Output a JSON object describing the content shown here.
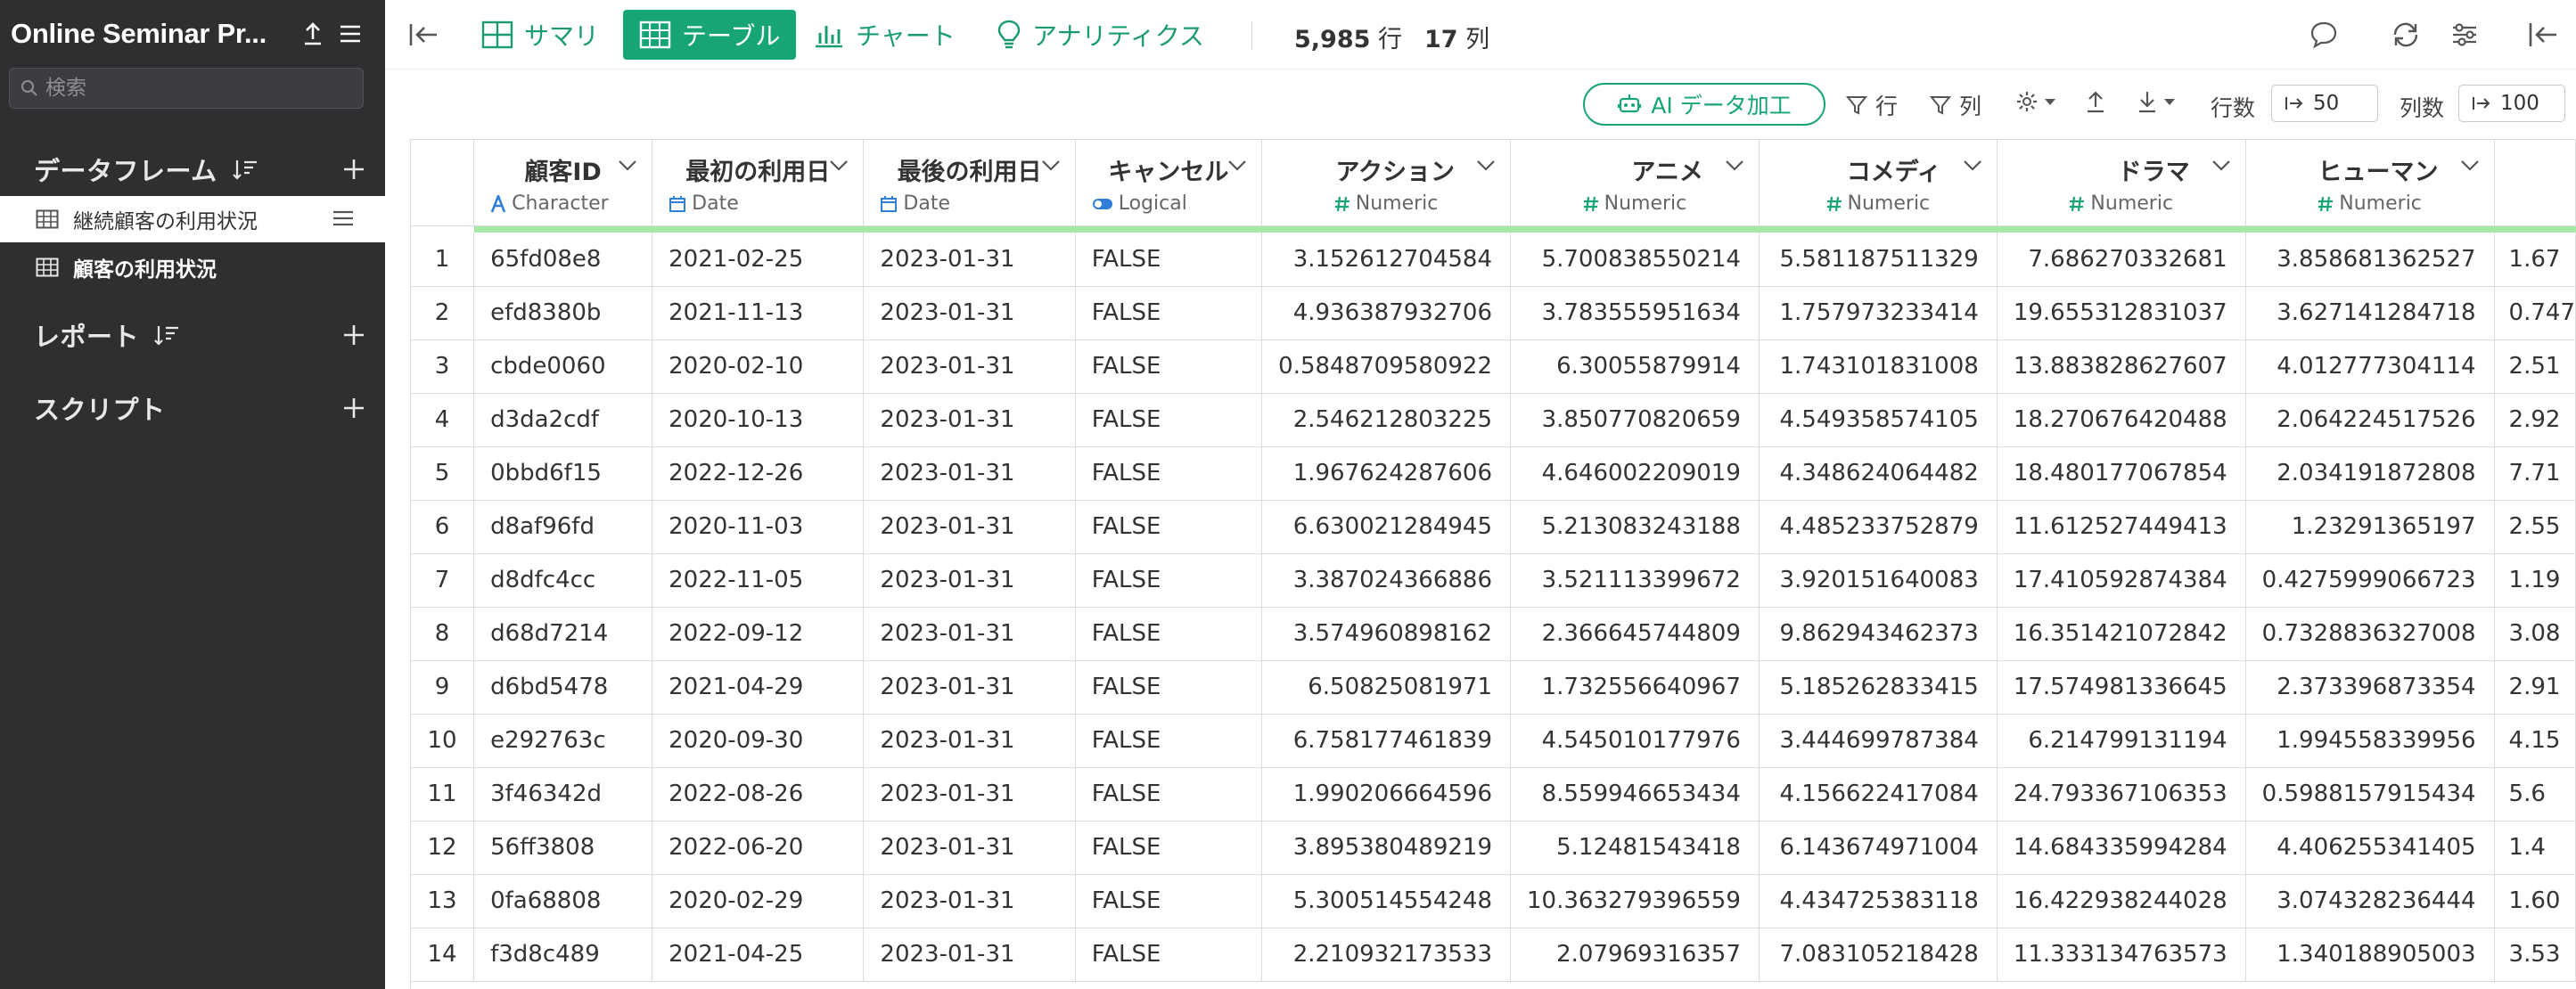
{
  "sidebar": {
    "project_title": "Online Seminar Pr...",
    "search_placeholder": "検索",
    "sections": {
      "dataframes": "データフレーム",
      "reports": "レポート",
      "scripts": "スクリプト"
    },
    "dataframes": [
      {
        "label": "継続顧客の利用状況"
      },
      {
        "label": "顧客の利用状況"
      }
    ]
  },
  "toolbar": {
    "summary": "サマリ",
    "table": "テーブル",
    "chart": "チャート",
    "analytics": "アナリティクス",
    "row_count": "5,985",
    "row_unit": "行",
    "col_count": "17",
    "col_unit": "列"
  },
  "subbar": {
    "ai_label": "AI データ加工",
    "row_filter": "行",
    "col_filter": "列",
    "rows_label": "行数",
    "rows_value": "50",
    "cols_label": "列数",
    "cols_value": "100"
  },
  "table": {
    "columns": [
      {
        "name": "顧客ID",
        "type": "Character"
      },
      {
        "name": "最初の利用日",
        "type": "Date"
      },
      {
        "name": "最後の利用日",
        "type": "Date"
      },
      {
        "name": "キャンセル",
        "type": "Logical"
      },
      {
        "name": "アクション",
        "type": "Numeric"
      },
      {
        "name": "アニメ",
        "type": "Numeric"
      },
      {
        "name": "コメディ",
        "type": "Numeric"
      },
      {
        "name": "ドラマ",
        "type": "Numeric"
      },
      {
        "name": "ヒューマン",
        "type": "Numeric"
      }
    ],
    "rows": [
      [
        "1",
        "65fd08e8",
        "2021-02-25",
        "2023-01-31",
        "FALSE",
        "3.152612704584",
        "5.700838550214",
        "5.581187511329",
        "7.686270332681",
        "3.858681362527",
        "1.67"
      ],
      [
        "2",
        "efd8380b",
        "2021-11-13",
        "2023-01-31",
        "FALSE",
        "4.936387932706",
        "3.783555951634",
        "1.757973233414",
        "19.655312831037",
        "3.627141284718",
        "0.747"
      ],
      [
        "3",
        "cbde0060",
        "2020-02-10",
        "2023-01-31",
        "FALSE",
        "0.5848709580922",
        "6.30055879914",
        "1.743101831008",
        "13.883828627607",
        "4.012777304114",
        "2.51"
      ],
      [
        "4",
        "d3da2cdf",
        "2020-10-13",
        "2023-01-31",
        "FALSE",
        "2.546212803225",
        "3.850770820659",
        "4.549358574105",
        "18.270676420488",
        "2.064224517526",
        "2.92"
      ],
      [
        "5",
        "0bbd6f15",
        "2022-12-26",
        "2023-01-31",
        "FALSE",
        "1.967624287606",
        "4.646002209019",
        "4.348624064482",
        "18.480177067854",
        "2.034191872808",
        "7.71"
      ],
      [
        "6",
        "d8af96fd",
        "2020-11-03",
        "2023-01-31",
        "FALSE",
        "6.630021284945",
        "5.213083243188",
        "4.485233752879",
        "11.612527449413",
        "1.23291365197",
        "2.55"
      ],
      [
        "7",
        "d8dfc4cc",
        "2022-11-05",
        "2023-01-31",
        "FALSE",
        "3.387024366886",
        "3.521113399672",
        "3.920151640083",
        "17.410592874384",
        "0.4275999066723",
        "1.19"
      ],
      [
        "8",
        "d68d7214",
        "2022-09-12",
        "2023-01-31",
        "FALSE",
        "3.574960898162",
        "2.366645744809",
        "9.862943462373",
        "16.351421072842",
        "0.7328836327008",
        "3.08"
      ],
      [
        "9",
        "d6bd5478",
        "2021-04-29",
        "2023-01-31",
        "FALSE",
        "6.50825081971",
        "1.732556640967",
        "5.185262833415",
        "17.574981336645",
        "2.373396873354",
        "2.91"
      ],
      [
        "10",
        "e292763c",
        "2020-09-30",
        "2023-01-31",
        "FALSE",
        "6.758177461839",
        "4.545010177976",
        "3.444699787384",
        "6.214799131194",
        "1.994558339956",
        "4.15"
      ],
      [
        "11",
        "3f46342d",
        "2022-08-26",
        "2023-01-31",
        "FALSE",
        "1.990206664596",
        "8.559946653434",
        "4.156622417084",
        "24.793367106353",
        "0.5988157915434",
        "5.6"
      ],
      [
        "12",
        "56ff3808",
        "2022-06-20",
        "2023-01-31",
        "FALSE",
        "3.895380489219",
        "5.12481543418",
        "6.143674971004",
        "14.684335994284",
        "4.406255341405",
        "1.4"
      ],
      [
        "13",
        "0fa68808",
        "2020-02-29",
        "2023-01-31",
        "FALSE",
        "5.300514554248",
        "10.363279396559",
        "4.434725383118",
        "16.422938244028",
        "3.074328236444",
        "1.60"
      ],
      [
        "14",
        "f3d8c489",
        "2021-04-25",
        "2023-01-31",
        "FALSE",
        "2.210932173533",
        "2.07969316357",
        "7.083105218428",
        "11.333134763573",
        "1.340188905003",
        "3.53"
      ]
    ]
  },
  "colors": {
    "accent": "#17a673",
    "sidebar_bg": "#2d2f31",
    "type_character": "#2f7fd8",
    "type_date": "#2f7fd8",
    "type_numeric": "#17a673",
    "header_greenbar": "#a6e8a6"
  }
}
